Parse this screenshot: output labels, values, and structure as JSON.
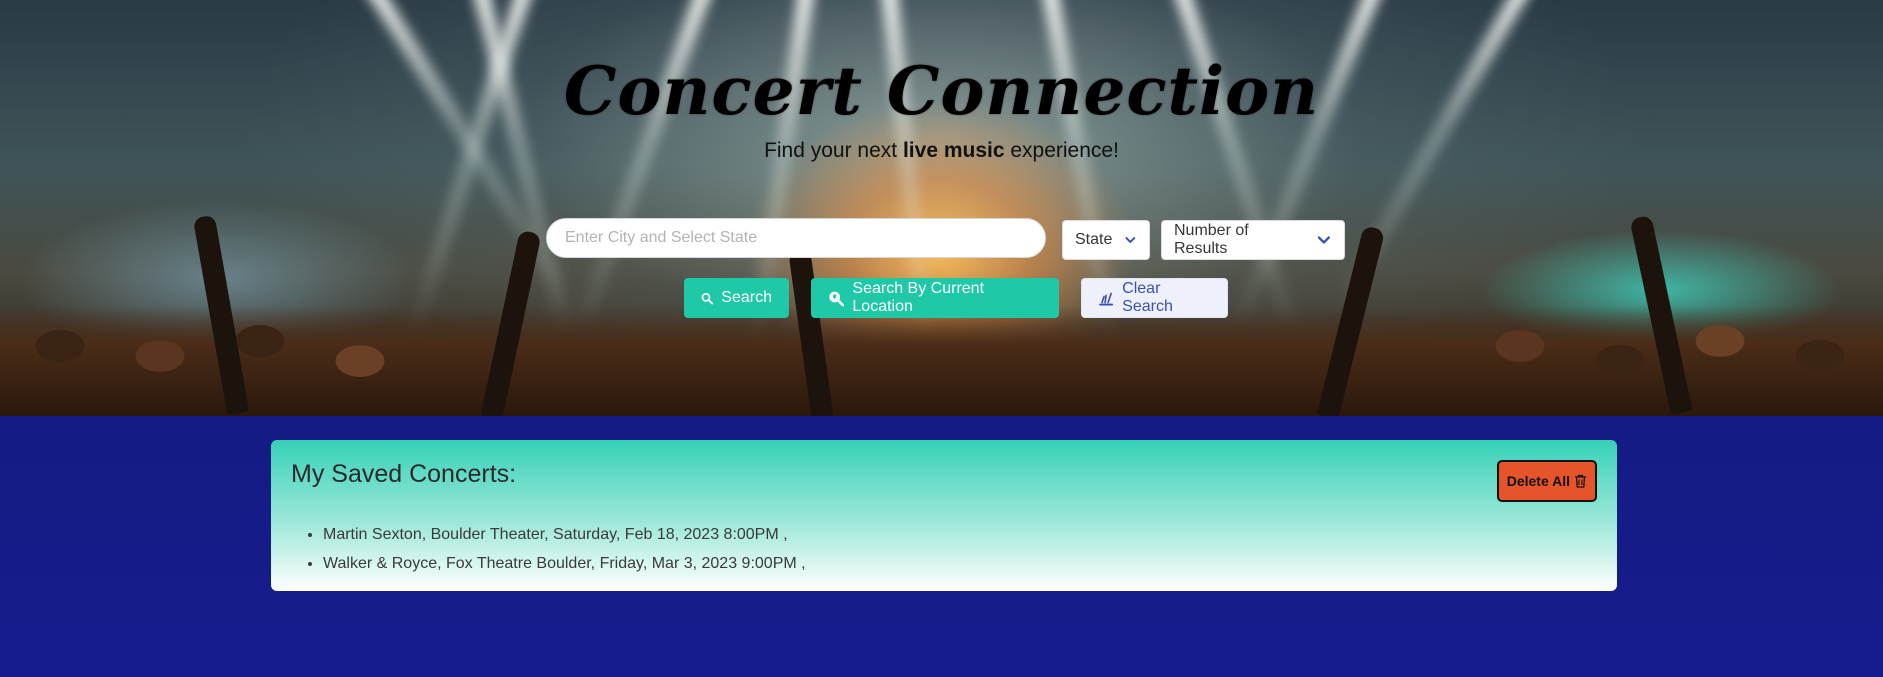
{
  "hero": {
    "title": "Concert Connection",
    "subtitle_prefix": "Find your next ",
    "subtitle_bold": "live music",
    "subtitle_suffix": " experience!"
  },
  "search": {
    "placeholder": "Enter City and Select State",
    "value": "",
    "state_select": "State",
    "results_select": "Number of Results",
    "search_button": "Search",
    "location_button": "Search By Current Location",
    "clear_button": "Clear Search"
  },
  "saved": {
    "title": "My Saved Concerts:",
    "delete_all": "Delete All",
    "items": [
      "Martin Sexton, Boulder Theater, Saturday, Feb 18, 2023 8:00PM ,",
      "Walker & Royce, Fox Theatre Boulder, Friday, Mar 3, 2023 9:00PM ,"
    ]
  },
  "colors": {
    "accent_teal": "#1fc9a8",
    "button_blue_text": "#3850b5",
    "delete_orange": "#e6552a",
    "page_background": "#161c8f"
  },
  "icons": {
    "search": "magnifier-icon",
    "location": "location-search-icon",
    "clear": "sweep-icon",
    "delete": "trash-icon",
    "dropdown": "chevron-down-icon"
  }
}
